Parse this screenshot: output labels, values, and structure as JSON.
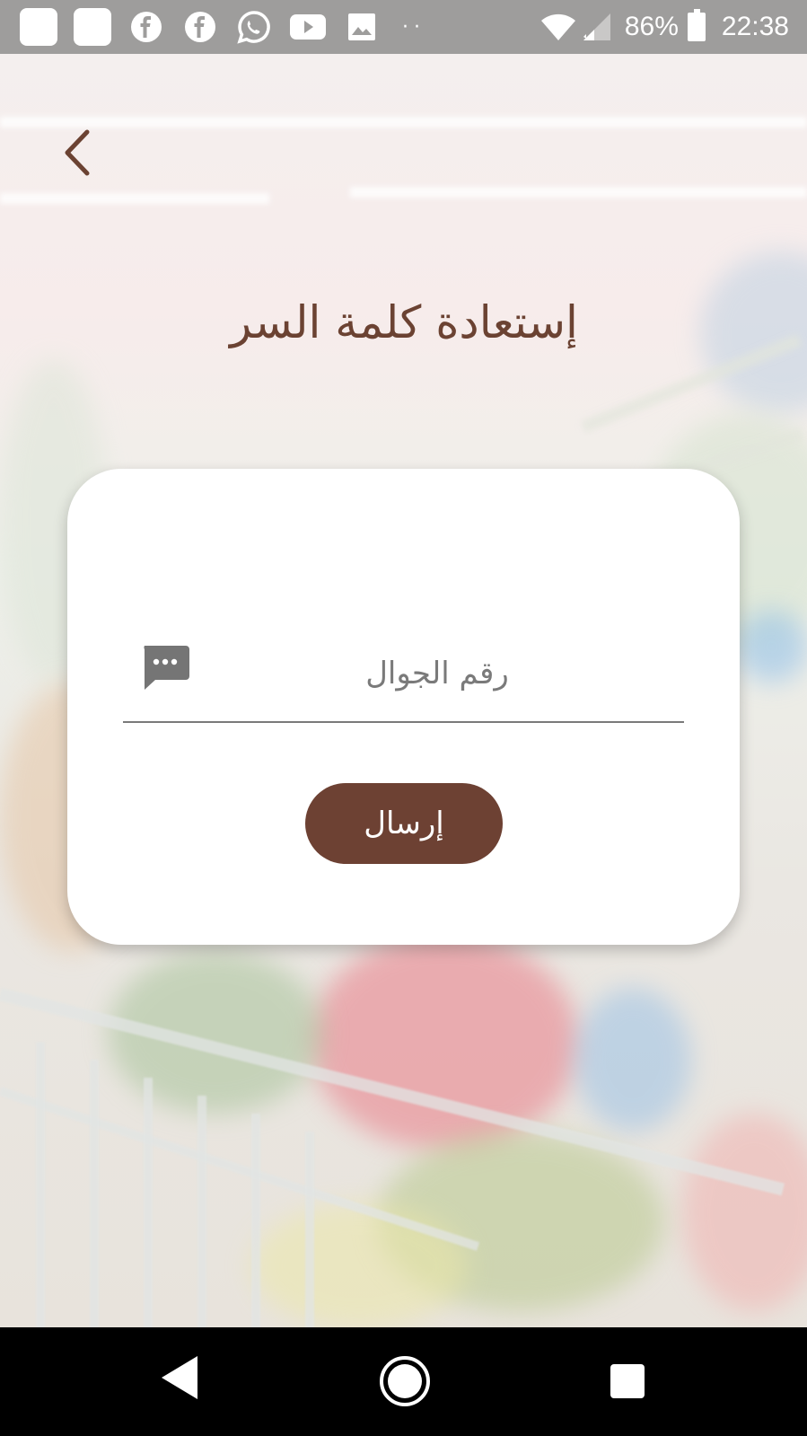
{
  "status_bar": {
    "battery_percent": "86%",
    "time": "22:38",
    "notification_icons": [
      "app-square-icon",
      "app-square-icon",
      "facebook-icon",
      "facebook-icon",
      "whatsapp-icon",
      "youtube-icon",
      "gallery-icon"
    ],
    "overflow_dots": "··"
  },
  "header": {
    "back_icon": "chevron-left-icon",
    "title": "إستعادة كلمة السر"
  },
  "form": {
    "phone_placeholder": "رقم الجوال",
    "phone_value": "",
    "phone_icon": "message-icon",
    "submit_label": "إرسال"
  },
  "colors": {
    "brand_brown": "#6d4133",
    "title_brown": "#6b4232",
    "card_bg": "#ffffff"
  },
  "nav_bar": {
    "icons": [
      "nav-back-icon",
      "nav-home-icon",
      "nav-recents-icon"
    ]
  }
}
